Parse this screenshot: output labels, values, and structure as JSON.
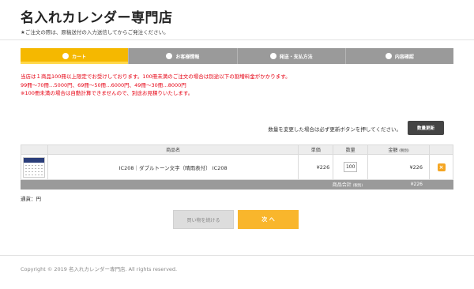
{
  "header": {
    "title": "名入れカレンダー専門店",
    "notice": "★ご注文の際は、原稿送付の入力送信してからご発注ください。"
  },
  "steps": [
    {
      "label": "カート",
      "active": true
    },
    {
      "label": "お客様情報",
      "active": false
    },
    {
      "label": "発送・支払方法",
      "active": false
    },
    {
      "label": "内容確認",
      "active": false
    }
  ],
  "warnings": [
    "当店は１商品100冊以上限定でお受けしております。100冊未満のご注文の場合は別途以下の割増料金がかかります。",
    "99冊〜70冊…5000円、69冊〜50冊…6000円、49冊〜30冊…8000円",
    "※100冊未満の場合は自動計算できませんので、別途お見積りいたします。"
  ],
  "cart": {
    "qty_note": "数量を変更した場合は必ず更新ボタンを押してください。",
    "update_label": "数量更新",
    "headers": {
      "product": "商品名",
      "unit_price": "単価",
      "quantity": "数量",
      "amount": "金額",
      "amount_note": "(税別)"
    },
    "items": [
      {
        "name": "IC208｜ダブルトーン文字（晴雨表付） IC208",
        "unit_price": "¥226",
        "quantity": "100",
        "amount": "¥226",
        "remove_icon": "close-icon"
      }
    ],
    "subtotal_label": "商品合計",
    "subtotal_note": "(税別)",
    "subtotal_value": "¥226",
    "currency_line": "通貨：円"
  },
  "actions": {
    "continue_label": "買い物を続ける",
    "next_label": "次 へ"
  },
  "footer": {
    "copyright": "Copyright © 2019 名入れカレンダー専門店. All rights reserved."
  },
  "colors": {
    "accent": "#f5b800",
    "warning": "#e60012",
    "step_inactive": "#9a9a9a",
    "remove": "#f5a623"
  }
}
